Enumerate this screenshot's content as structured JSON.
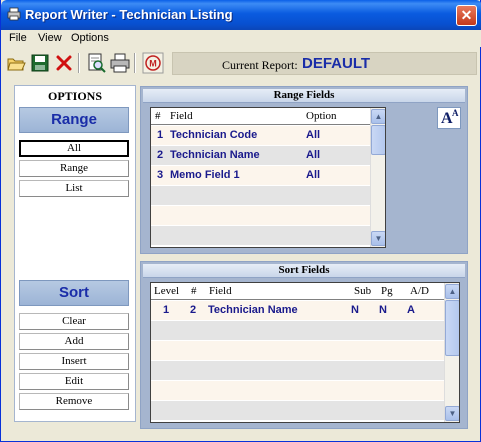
{
  "window": {
    "title": "Report Writer - Technician Listing",
    "close_glyph": "✕"
  },
  "menu": [
    "File",
    "View",
    "Options"
  ],
  "toolbar": {
    "icons": [
      "open-folder-icon",
      "save-disk-icon",
      "delete-x-icon",
      "print-preview-icon",
      "print-icon",
      "report-mode-icon"
    ],
    "current_label": "Current Report:",
    "current_value": "DEFAULT"
  },
  "options": {
    "title": "OPTIONS",
    "range_section": "Range",
    "range_buttons": [
      "All",
      "Range",
      "List"
    ],
    "sort_section": "Sort",
    "sort_buttons": [
      "Clear",
      "Add",
      "Insert",
      "Edit",
      "Remove"
    ]
  },
  "range_fields": {
    "title": "Range Fields",
    "font_glyph": "A",
    "columns": [
      "#",
      "Field",
      "Option"
    ],
    "rows": [
      {
        "num": "1",
        "field": "Technician Code",
        "option": "All"
      },
      {
        "num": "2",
        "field": "Technician Name",
        "option": "All"
      },
      {
        "num": "3",
        "field": "Memo Field 1",
        "option": "All"
      }
    ]
  },
  "sort_fields": {
    "title": "Sort Fields",
    "columns": [
      "Level",
      "#",
      "Field",
      "Sub",
      "Pg",
      "A/D"
    ],
    "rows": [
      {
        "level": "1",
        "num": "2",
        "field": "Technician Name",
        "sub": "N",
        "pg": "N",
        "ad": "A"
      }
    ]
  },
  "colors": {
    "accent": "#1A2DA8",
    "panel": "#A5B5CF",
    "titlebar": "#0A5BE0"
  }
}
